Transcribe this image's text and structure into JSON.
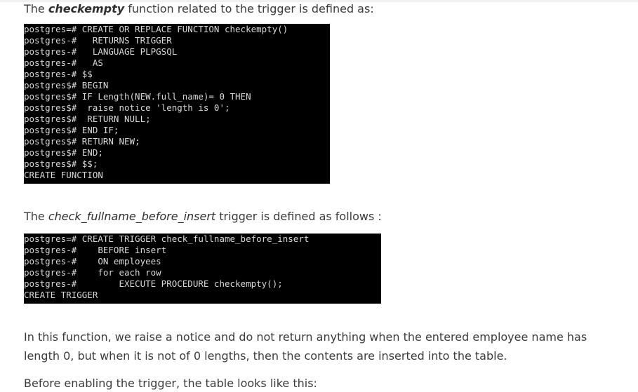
{
  "intro_function": {
    "prefix": "The ",
    "name": "checkempty",
    "suffix": " function related to the trigger is defined as:"
  },
  "function_terminal": {
    "lines": [
      "postgres=# CREATE OR REPLACE FUNCTION checkempty()",
      "postgres-#   RETURNS TRIGGER",
      "postgres-#   LANGUAGE PLPGSQL",
      "postgres-#   AS",
      "postgres-# $$",
      "postgres$# BEGIN",
      "postgres$# IF Length(NEW.full_name)= 0 THEN",
      "postgres$#  raise notice 'length is 0';",
      "postgres$#  RETURN NULL;",
      "postgres$# END IF;",
      "postgres$# RETURN NEW;",
      "postgres$# END;",
      "postgres$# $$;",
      "CREATE FUNCTION"
    ]
  },
  "intro_trigger": {
    "prefix": "The ",
    "name": "check_fullname_before_insert",
    "suffix": " trigger is defined as follows :"
  },
  "trigger_terminal": {
    "lines": [
      "postgres=# CREATE TRIGGER check_fullname_before_insert",
      "postgres-#    BEFORE insert",
      "postgres-#    ON employees",
      "postgres-#    for each row",
      "postgres-#        EXECUTE PROCEDURE checkempty();",
      "CREATE TRIGGER"
    ]
  },
  "explanation": "In this function, we raise a notice and do not return anything when the entered employee name has length 0, but when it is not of 0 lengths, then the contents are inserted into the table.",
  "before_enabling": "Before enabling the trigger, the table looks like this:"
}
